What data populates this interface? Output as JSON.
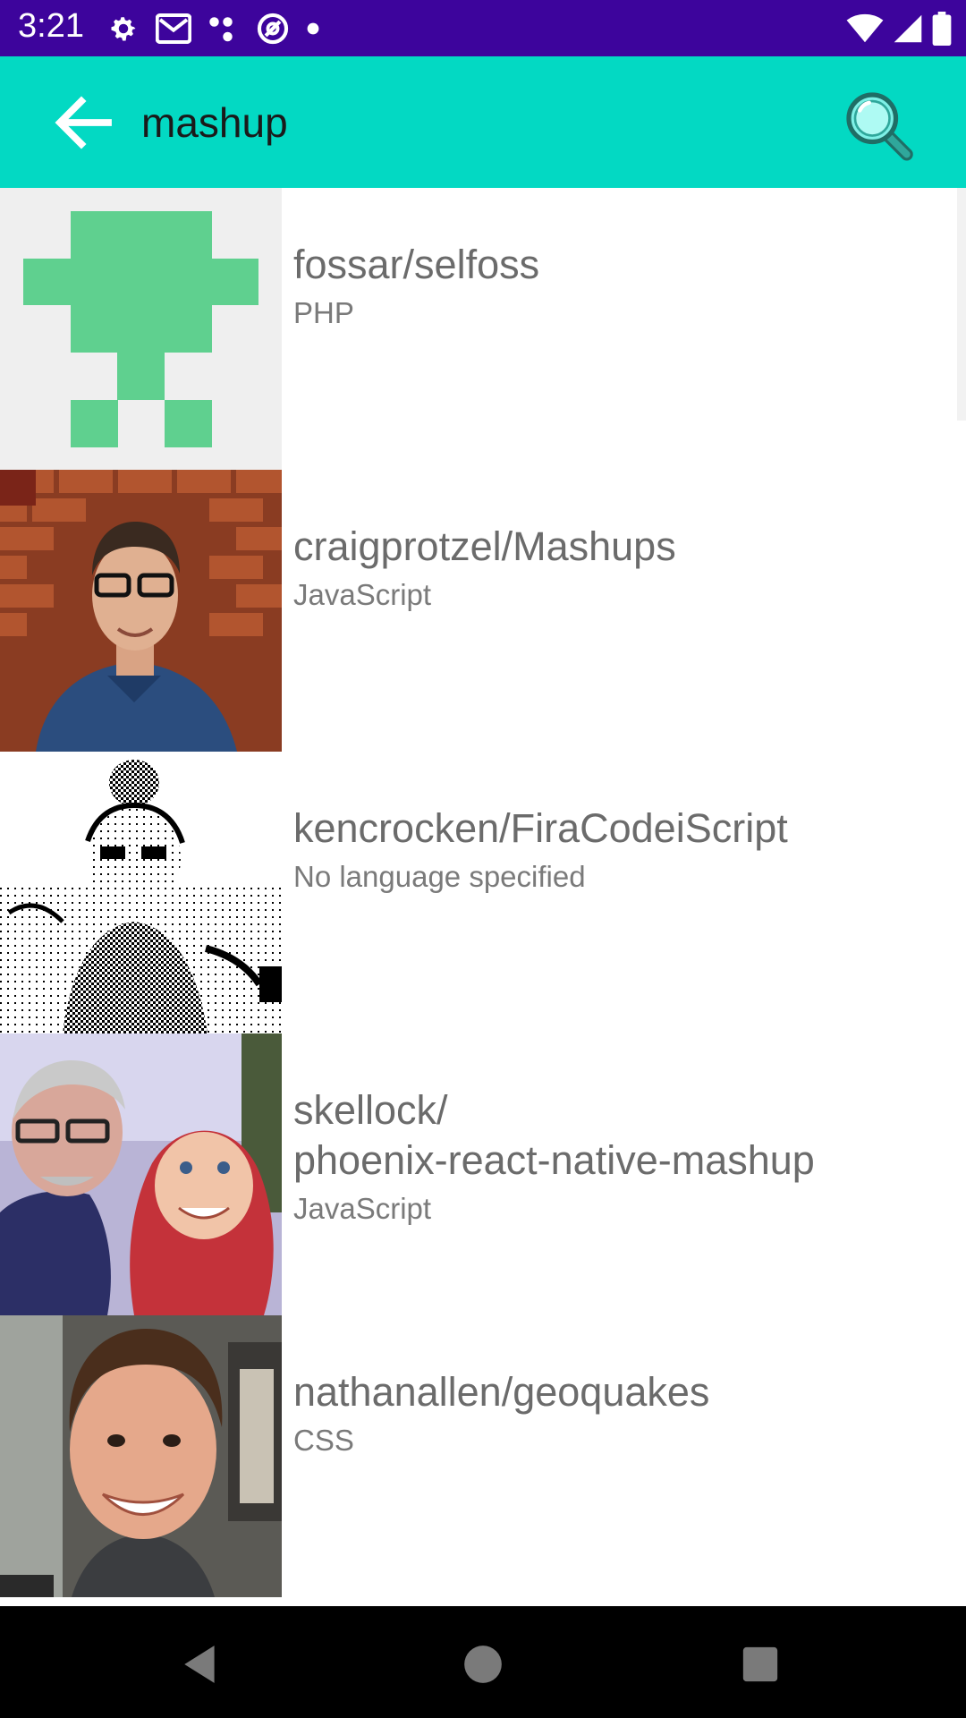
{
  "status_bar": {
    "time": "3:21",
    "left_icons": [
      "gear-icon",
      "gmail-icon",
      "dots-icon",
      "at-sign-icon",
      "dot-icon"
    ],
    "right_icons": [
      "wifi-icon",
      "signal-icon",
      "battery-icon"
    ],
    "background": "#3d049c"
  },
  "app_bar": {
    "back_icon": "arrow-left-icon",
    "query": "mashup",
    "search_icon": "magnifier-icon",
    "background": "#03d9c3"
  },
  "results": [
    {
      "name": "fossar/selfoss",
      "language": "PHP",
      "avatar": "green-pixel-identicon"
    },
    {
      "name": "craigprotzel/Mashups",
      "language": "JavaScript",
      "avatar": "photo-man-glasses-brick-wall"
    },
    {
      "name": "kencrocken/FiraCodeiScript",
      "language": "No language specified",
      "avatar": "dithered-bw-photo"
    },
    {
      "name": "skellock/\nphoenix-react-native-mashup",
      "language": "JavaScript",
      "avatar": "photo-man-and-child"
    },
    {
      "name": "nathanallen/geoquakes",
      "language": "CSS",
      "avatar": "photo-smiling-man"
    }
  ],
  "nav_bar": {
    "icons": [
      "back-triangle-icon",
      "home-circle-icon",
      "recents-square-icon"
    ]
  }
}
